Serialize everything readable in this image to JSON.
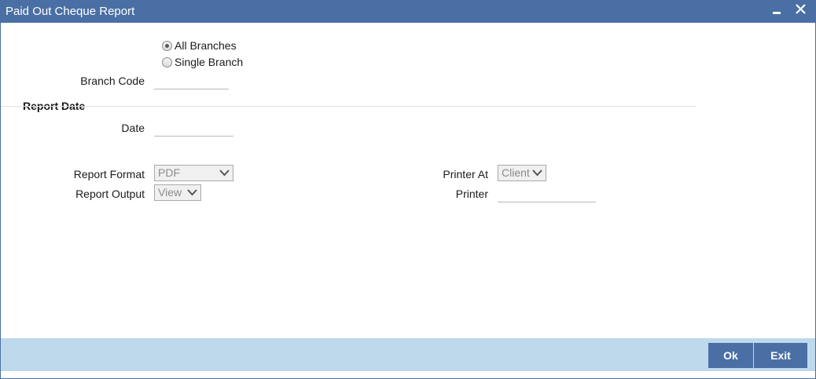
{
  "window": {
    "title": "Paid Out Cheque Report"
  },
  "branch_options": [
    {
      "label": "All Branches",
      "selected": true
    },
    {
      "label": "Single Branch",
      "selected": false
    }
  ],
  "branch_code": {
    "label": "Branch Code",
    "value": ""
  },
  "report_date": {
    "section_title": "Report Date",
    "date_label": "Date",
    "date_value": ""
  },
  "report_format": {
    "label": "Report Format",
    "value": "PDF"
  },
  "report_output": {
    "label": "Report Output",
    "value": "View"
  },
  "printer_at": {
    "label": "Printer At",
    "value": "Client"
  },
  "printer": {
    "label": "Printer",
    "value": ""
  },
  "buttons": {
    "ok": "Ok",
    "exit": "Exit"
  },
  "colors": {
    "titlebar": "#4a6fa5",
    "footer": "#bfd9ec",
    "button": "#4a6fa5"
  }
}
